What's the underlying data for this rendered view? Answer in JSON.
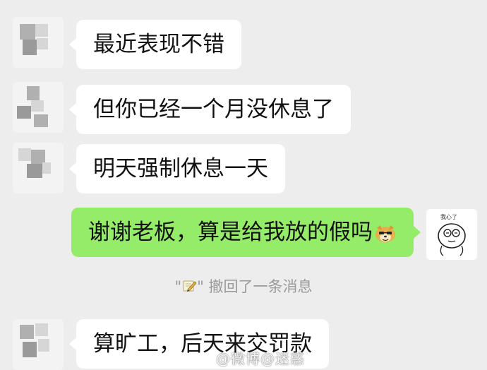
{
  "messages": [
    {
      "side": "left",
      "text": "最近表现不错"
    },
    {
      "side": "left",
      "text": "但你已经一个月没休息了"
    },
    {
      "side": "left",
      "text": "明天强制休息一天"
    },
    {
      "side": "right",
      "text": "谢谢老板，算是给我放的假吗",
      "emoji": "doge-emoji"
    },
    {
      "side": "left",
      "text": "算旷工，后天来交罚款"
    }
  ],
  "system_notice": {
    "open_quote": "\"",
    "close_quote": "\"",
    "text": "撤回了一条消息",
    "icon": "pencil-emoji"
  },
  "watermark": "@微博@迷惑",
  "colors": {
    "background": "#ededed",
    "bubble_in": "#ffffff",
    "bubble_out": "#95ec69",
    "system_text": "#9a9a9a"
  }
}
